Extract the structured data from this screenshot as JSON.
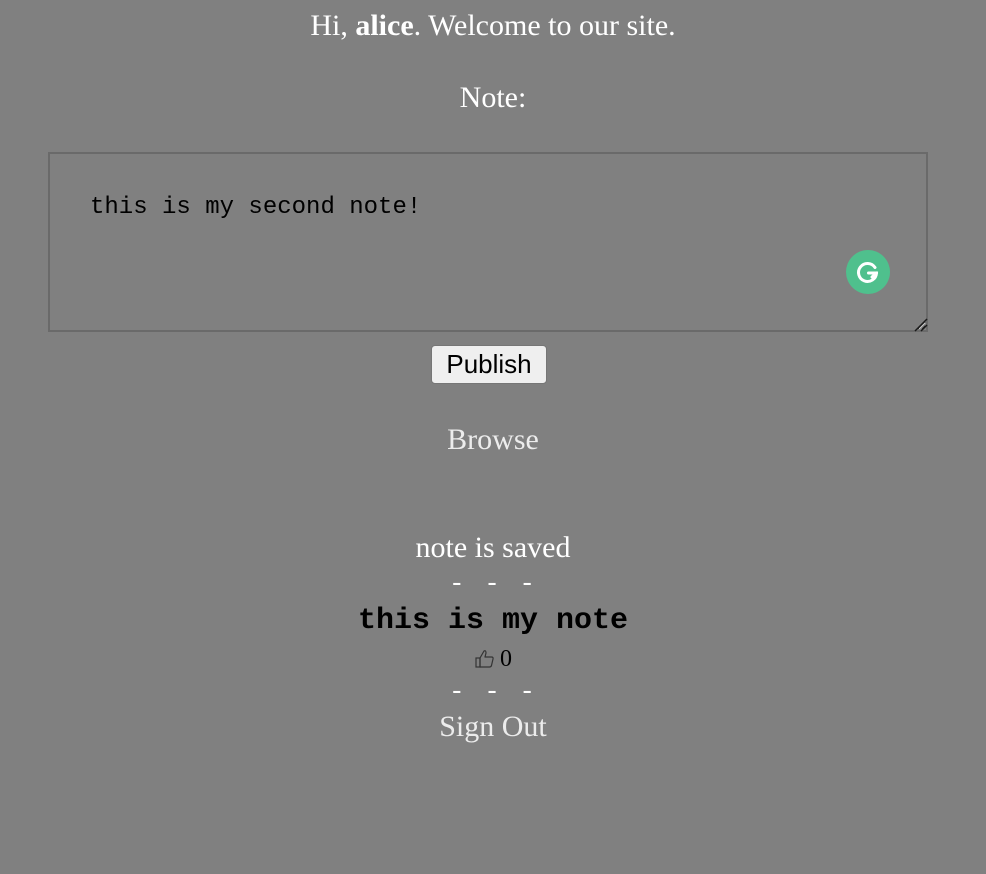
{
  "header": {
    "greeting_prefix": "Hi, ",
    "username": "alice",
    "greeting_suffix": ". Welcome to our site."
  },
  "editor": {
    "label": "Note:",
    "value": "this is my second note!",
    "publish_label": "Publish"
  },
  "nav": {
    "browse_label": "Browse",
    "signout_label": "Sign Out"
  },
  "status": {
    "message": "note is saved"
  },
  "notes": [
    {
      "separator_top": "- - -",
      "text": "this is my note",
      "likes": "0",
      "separator_bottom": "- - -"
    }
  ],
  "icons": {
    "grammarly": "grammarly-icon",
    "thumb": "thumbs-up-icon",
    "resize": "resize-grip-icon"
  },
  "colors": {
    "background": "#808080",
    "grammarly": "#4fc08d"
  }
}
